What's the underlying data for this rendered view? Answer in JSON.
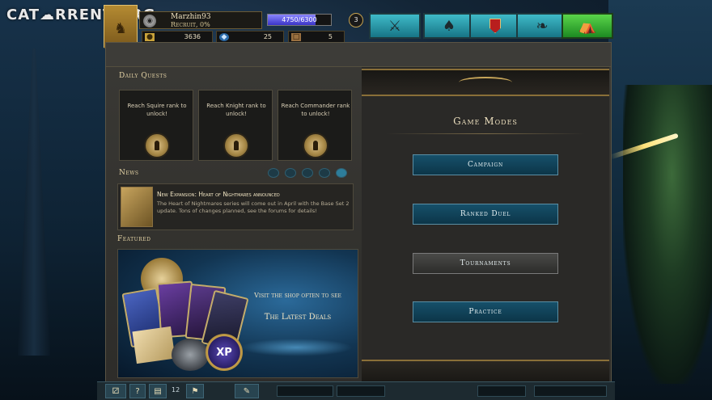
{
  "watermark": "CAT☁RRENT.ORG",
  "player": {
    "name": "Marzhin93",
    "rank_progress": "Recruit, 0%",
    "xp_text": "4750/6300",
    "xp_fraction": 0.754,
    "level": "3"
  },
  "resources": {
    "gold": "3636",
    "gems": "25",
    "packs": "5"
  },
  "nav": [
    {
      "id": "battle",
      "icon": "crossed-swords-icon",
      "glyph": "⚔"
    },
    {
      "id": "cards",
      "icon": "cards-icon",
      "glyph": "♠"
    },
    {
      "id": "guild",
      "icon": "banner-shield-icon",
      "glyph": ""
    },
    {
      "id": "rank",
      "icon": "laurel-wreath-icon",
      "glyph": "❧"
    },
    {
      "id": "shop",
      "icon": "shop-stall-icon",
      "glyph": "⛺"
    }
  ],
  "daily_quests": {
    "title": "Daily Quests",
    "items": [
      {
        "text": "Reach Squire rank to unlock!"
      },
      {
        "text": "Reach Knight rank to unlock!"
      },
      {
        "text": "Reach Commander rank to unlock!"
      }
    ]
  },
  "news": {
    "title": "News",
    "page_count": 5,
    "active_index": 4,
    "headline": "New Expansion: Heart of Nightmares announced",
    "body": "The Heart of Nightmares series will come out in April with the Base Set 2 update. Tons of changes planned, see the forums for details!"
  },
  "featured": {
    "title": "Featured",
    "line1": "Visit the shop often to see",
    "line2": "The Latest Deals",
    "xp_badge": "XP"
  },
  "game_modes": {
    "title": "Game Modes",
    "buttons": [
      {
        "label": "Campaign",
        "state": "highlighted"
      },
      {
        "label": "Ranked Duel",
        "state": "highlighted"
      },
      {
        "label": "Tournaments",
        "state": "normal"
      },
      {
        "label": "Practice",
        "state": "highlighted"
      }
    ]
  },
  "bottom_bar": {
    "count": "12",
    "help_glyph": "?"
  },
  "colors": {
    "accent_teal": "#177586",
    "shop_green": "#1d8a22",
    "xp_purple": "#3a34c8",
    "gold": "#c8a23a"
  }
}
